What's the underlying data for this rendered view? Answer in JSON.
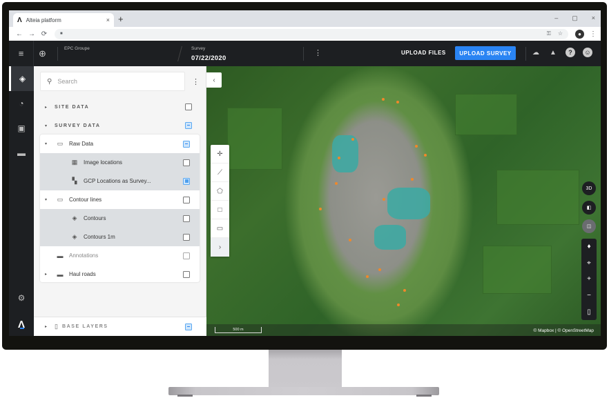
{
  "browser": {
    "tab_title": "Alteia platform",
    "tab_logo": "Λ",
    "close_tab": "×",
    "new_tab": "+",
    "window_controls": [
      "–",
      "▢",
      "×"
    ],
    "nav": {
      "back": "←",
      "forward": "→",
      "reload": "⟳"
    },
    "lock_icon": "🔒",
    "addr_icons": {
      "key": "⚿",
      "star": "☆"
    },
    "profile": "●",
    "menu": "⋮"
  },
  "header": {
    "menu_icon": "≡",
    "globe_icon": "🌐",
    "organization": "EPC Groupe",
    "survey_label": "Survey",
    "survey_date": "07/22/2020",
    "kebab": "⋮",
    "upload_files": "UPLOAD FILES",
    "upload_survey": "UPLOAD SURVEY",
    "icons": {
      "cloud_upload": "☁",
      "bell": "🔔",
      "help": "?",
      "account": "●"
    },
    "accent_color": "#2a84f3"
  },
  "rail": {
    "items": [
      {
        "name": "layers",
        "glyph": "◈",
        "active": true
      },
      {
        "name": "dashboard",
        "glyph": "◔",
        "active": false
      },
      {
        "name": "images",
        "glyph": "▣",
        "active": false
      },
      {
        "name": "folder",
        "glyph": "▬",
        "active": false
      }
    ],
    "settings_glyph": "⚙",
    "logo": "Λ"
  },
  "panel": {
    "search_placeholder": "Search",
    "search_icon": "⚲",
    "kebab": "⋮",
    "sections": {
      "site_data": {
        "label": "SITE DATA",
        "expanded": false,
        "state": "unchecked"
      },
      "survey_data": {
        "label": "SURVEY DATA",
        "expanded": true,
        "state": "partial"
      }
    },
    "tree": [
      {
        "label": "Raw Data",
        "type": "folder",
        "caret": "▾",
        "icon": "🗀",
        "state": "partial"
      },
      {
        "label": "Image locations",
        "type": "child",
        "icon": "▦",
        "state": "unchecked"
      },
      {
        "label": "GCP Locations as Survey...",
        "type": "child",
        "icon": "▚",
        "state": "checked"
      },
      {
        "label": "Contour lines",
        "type": "folder",
        "caret": "▾",
        "icon": "🗀",
        "state": "unchecked"
      },
      {
        "label": "Contours",
        "type": "child",
        "icon": "◈",
        "state": "unchecked"
      },
      {
        "label": "Contours 1m",
        "type": "child",
        "icon": "◈",
        "state": "unchecked"
      },
      {
        "label": "Annotations",
        "type": "folder",
        "caret": "",
        "icon": "▬",
        "state": "unchecked",
        "dim": true
      },
      {
        "label": "Haul roads",
        "type": "folder",
        "caret": "▸",
        "icon": "▬",
        "state": "unchecked"
      }
    ],
    "base_layers": {
      "label": "BASE LAYERS",
      "caret": "▸",
      "icon": "▯",
      "state": "partial"
    },
    "caret_collapsed": "▸",
    "caret_expanded": "▾"
  },
  "map": {
    "collapse_icon": "‹",
    "tools": [
      {
        "name": "point",
        "glyph": "✛"
      },
      {
        "name": "line",
        "glyph": "⟋"
      },
      {
        "name": "polygon",
        "glyph": "⬠"
      },
      {
        "name": "rectangle",
        "glyph": "□"
      },
      {
        "name": "measure",
        "glyph": "▭"
      },
      {
        "name": "expand",
        "glyph": "›"
      }
    ],
    "right_controls": [
      {
        "name": "3d-view",
        "glyph": "3D"
      },
      {
        "name": "layer-compare",
        "glyph": "◧"
      },
      {
        "name": "split-view",
        "glyph": "◫"
      }
    ],
    "stack_controls": [
      {
        "name": "compass",
        "glyph": "♦"
      },
      {
        "name": "zoom-to-extent",
        "glyph": "⌖"
      },
      {
        "name": "zoom-in",
        "glyph": "+"
      },
      {
        "name": "zoom-out",
        "glyph": "−"
      },
      {
        "name": "basemap",
        "glyph": "▯"
      }
    ],
    "scale": "500 m",
    "attribution": "© Mapbox | © OpenStreetMap"
  }
}
